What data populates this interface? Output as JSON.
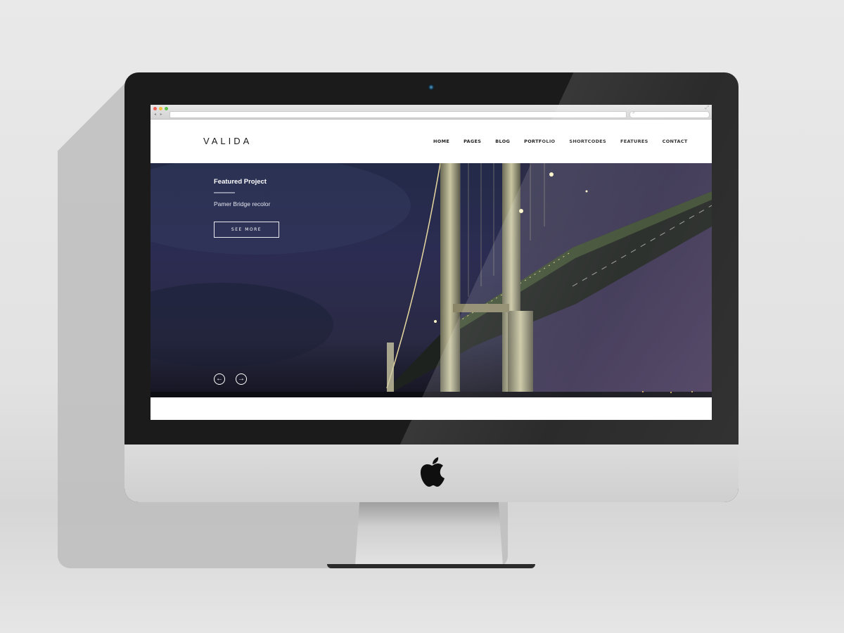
{
  "site": {
    "logo": "VALIDA",
    "nav": [
      "HOME",
      "PAGES",
      "BLOG",
      "PORTFOLIO",
      "SHORTCODES",
      "FEATURES",
      "CONTACT"
    ]
  },
  "hero": {
    "label": "Featured Project",
    "title": "Pamer Bridge recolor",
    "button": "SEE MORE",
    "prev_icon": "arrow-left-icon",
    "next_icon": "arrow-right-icon"
  },
  "colors": {
    "sky": "#232a48",
    "bezel": "#1b1b1b",
    "chin": "#d6d6d6",
    "text_dark": "#1b1b1b"
  }
}
